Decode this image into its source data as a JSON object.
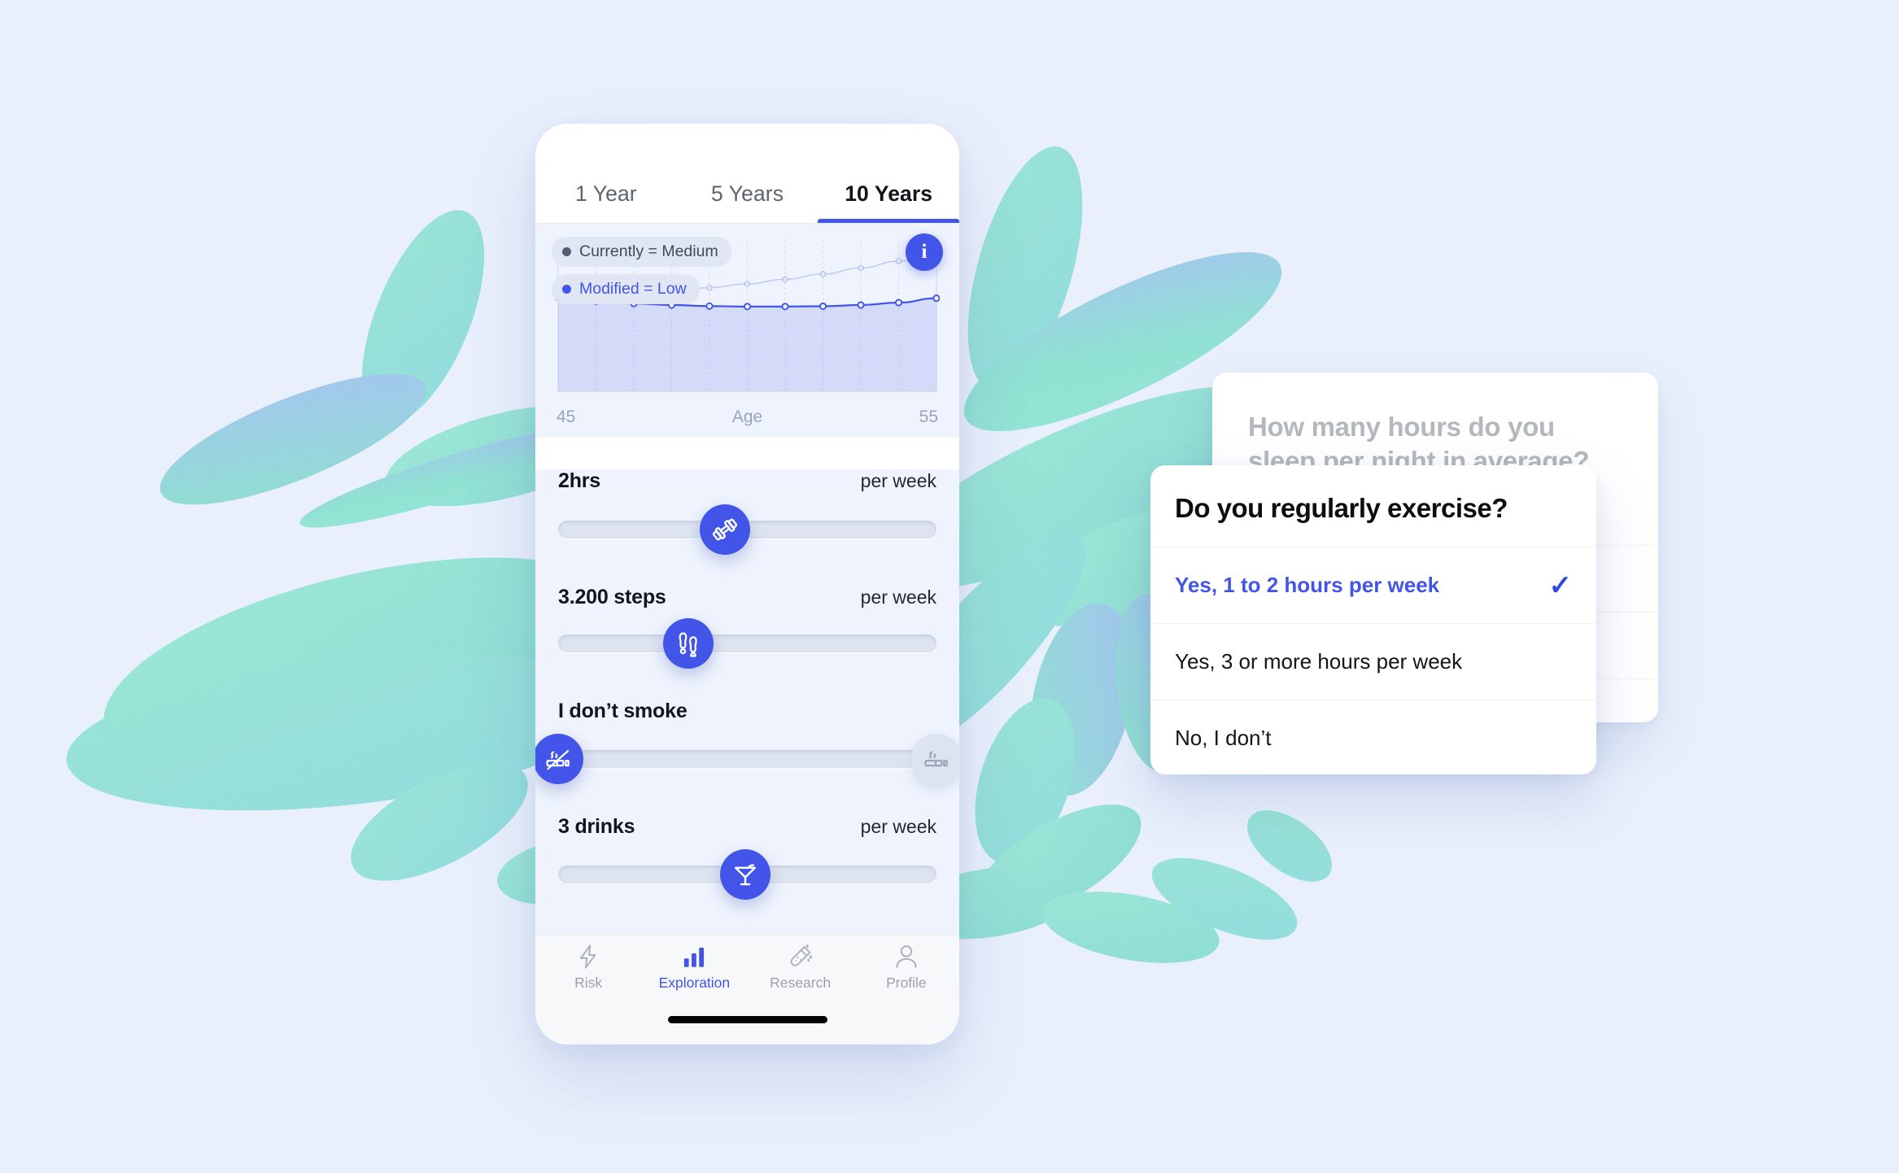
{
  "theme": {
    "bg": "#e9f0fc",
    "accent": "#4355e8",
    "leaf_green": "#7fe0c8",
    "leaf_blue": "#8fb6ee",
    "panel": "#eef3fd"
  },
  "phone": {
    "tabs": [
      {
        "label": "1 Year",
        "active": false
      },
      {
        "label": "5 Years",
        "active": false
      },
      {
        "label": "10 Years",
        "active": true
      }
    ],
    "chart": {
      "info_button_label": "i",
      "legend": [
        {
          "label": "Currently = Medium",
          "color": "#555d6e"
        },
        {
          "label": "Modified = Low",
          "color": "#4355e8"
        }
      ],
      "x_min_label": "45",
      "x_axis_label": "Age",
      "x_max_label": "55"
    },
    "sliders": [
      {
        "name": "exercise",
        "value_label": "2hrs",
        "unit_label": "per week",
        "icon": "dumbbell-icon",
        "position_pct": 61,
        "active": true
      },
      {
        "name": "steps",
        "value_label": "3.200 steps",
        "unit_label": "per week",
        "icon": "footsteps-icon",
        "position_pct": 50,
        "active": true
      },
      {
        "name": "smoking",
        "value_label": "I don’t smoke",
        "unit_label": "",
        "icon": "no-smoking-icon",
        "position_pct": 0,
        "active": true,
        "secondary_icon": "cigarette-icon",
        "secondary_position_pct": 100,
        "secondary_active": false
      },
      {
        "name": "drinks",
        "value_label": "3 drinks",
        "unit_label": "per week",
        "icon": "cocktail-icon",
        "position_pct": 50,
        "active": true
      }
    ],
    "nav": [
      {
        "label": "Risk",
        "icon": "bolt-icon",
        "active": false
      },
      {
        "label": "Exploration",
        "icon": "bar-chart-icon",
        "active": true
      },
      {
        "label": "Research",
        "icon": "test-tube-icon",
        "active": false
      },
      {
        "label": "Profile",
        "icon": "person-icon",
        "active": false
      }
    ]
  },
  "sleep_card": {
    "question": "How many hours do you sleep per night in average?"
  },
  "exercise_card": {
    "title": "Do you regularly exercise?",
    "options": [
      {
        "label": "Yes, 1 to 2 hours per week",
        "selected": true,
        "check": "✓"
      },
      {
        "label": "Yes, 3 or more hours per week",
        "selected": false,
        "check": ""
      },
      {
        "label": "No, I don’t",
        "selected": false,
        "check": ""
      }
    ]
  },
  "chart_data": {
    "type": "line",
    "title": "",
    "xlabel": "Age",
    "ylabel": "",
    "x": [
      45,
      46,
      47,
      48,
      49,
      50,
      51,
      52,
      53,
      54,
      55
    ],
    "xlim": [
      45,
      55
    ],
    "ylim": [
      0,
      100
    ],
    "grid": true,
    "legend_position": "top-left",
    "series": [
      {
        "name": "Currently = Medium",
        "color": "#9aa7e8",
        "values": [
          62,
          63.5,
          65,
          66.5,
          68.5,
          71,
          74,
          77.5,
          81.5,
          86,
          91
        ]
      },
      {
        "name": "Modified = Low",
        "color": "#4355e8",
        "values": [
          62,
          59.5,
          58,
          57,
          56.3,
          56,
          56,
          56.2,
          57,
          58.6,
          61.5
        ]
      }
    ]
  }
}
